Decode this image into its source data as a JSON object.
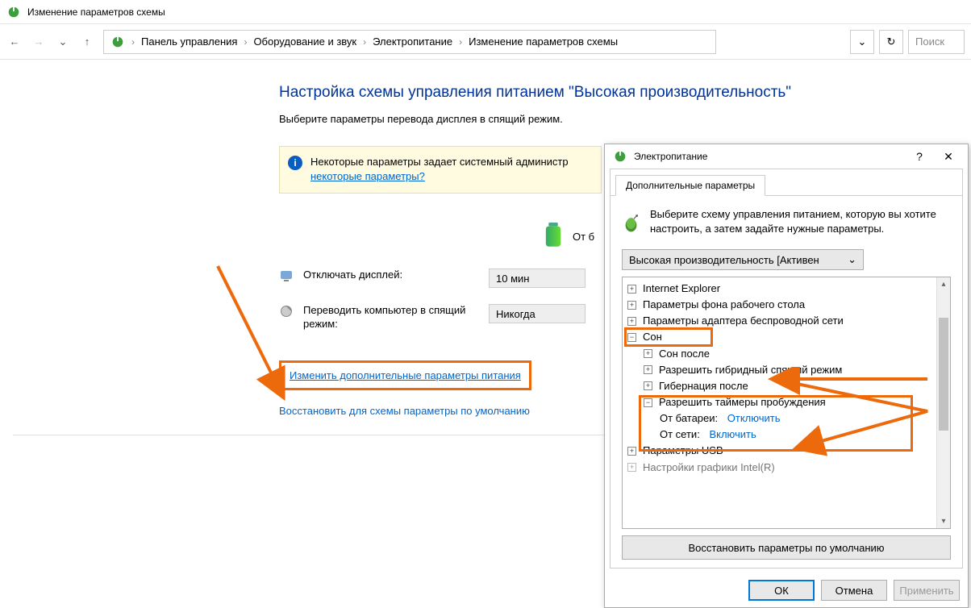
{
  "window": {
    "title": "Изменение параметров схемы"
  },
  "breadcrumb": {
    "items": [
      "Панель управления",
      "Оборудование и звук",
      "Электропитание",
      "Изменение параметров схемы"
    ]
  },
  "nav": {
    "search_placeholder": "Поиск"
  },
  "main": {
    "heading": "Настройка схемы управления питанием \"Высокая производительность\"",
    "subtext": "Выберите параметры перевода дисплея в спящий режим.",
    "info_text": "Некоторые параметры задает системный администр",
    "info_link": "некоторые параметры?",
    "battery_label": "От б",
    "fields": [
      {
        "label": "Отключать дисплей:",
        "value": "10 мин"
      },
      {
        "label": "Переводить компьютер в спящий режим:",
        "value": "Никогда"
      }
    ],
    "link_advanced": "Изменить дополнительные параметры питания",
    "link_restore": "Восстановить для схемы параметры по умолчанию"
  },
  "popup": {
    "title": "Электропитание",
    "tab": "Дополнительные параметры",
    "desc": "Выберите схему управления питанием, которую вы хотите настроить, а затем задайте нужные параметры.",
    "scheme": "Высокая производительность [Активен",
    "tree": {
      "n0": "Internet Explorer",
      "n1": "Параметры фона рабочего стола",
      "n2": "Параметры адаптера беспроводной сети",
      "n3": "Сон",
      "n3a": "Сон после",
      "n3b": "Разрешить гибридный спящий режим",
      "n3c": "Гибернация после",
      "n3d": "Разрешить таймеры пробуждения",
      "n3d1_label": "От батареи:",
      "n3d1_value": "Отключить",
      "n3d2_label": "От сети:",
      "n3d2_value": "Включить",
      "n4": "Параметры USB",
      "n5": "Настройки графики Intel(R)"
    },
    "restore_defaults": "Восстановить параметры по умолчанию",
    "buttons": {
      "ok": "ОК",
      "cancel": "Отмена",
      "apply": "Применить"
    }
  }
}
